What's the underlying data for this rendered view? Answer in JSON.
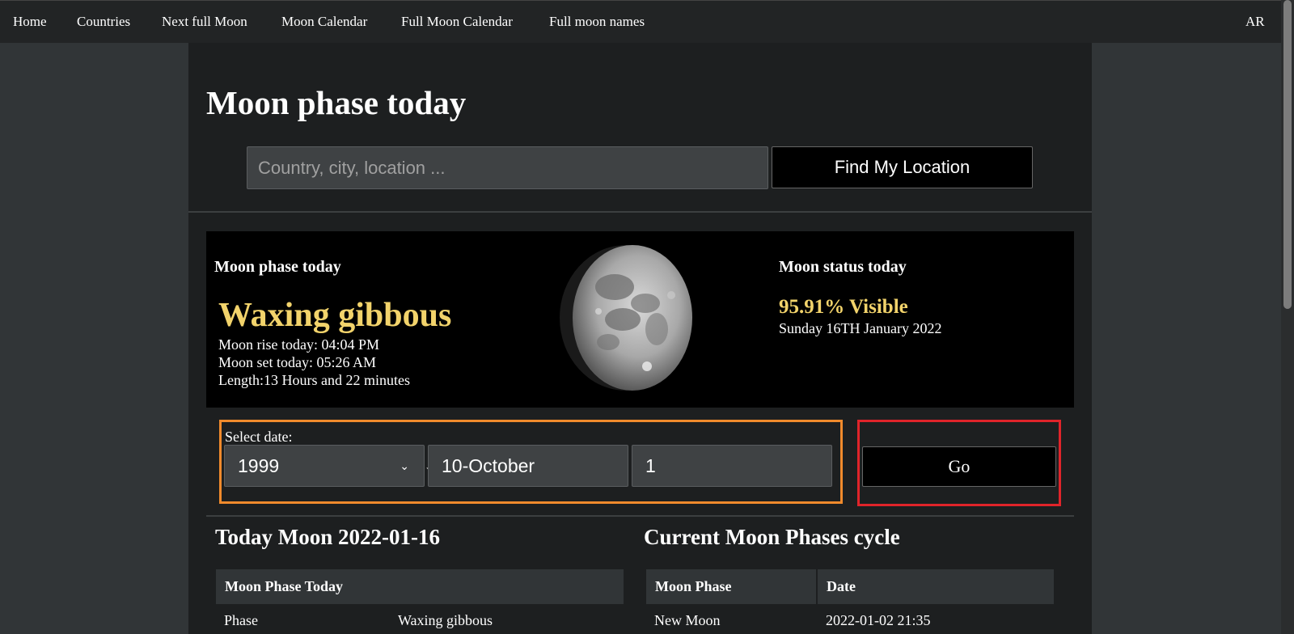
{
  "nav": {
    "items": [
      "Home",
      "Countries",
      "Next full Moon",
      "Moon Calendar",
      "Full Moon Calendar",
      "Full moon names"
    ],
    "lang": "AR"
  },
  "page": {
    "title": "Moon phase today",
    "search_placeholder": "Country, city, location ...",
    "locate_button": "Find My Location"
  },
  "hero": {
    "left_label": "Moon phase today",
    "phase_name": "Waxing gibbous",
    "moon_rise": "Moon rise today: 04:04 PM",
    "moon_set": "Moon set today: 05:26 AM",
    "length": "Length:13 Hours and 22 minutes",
    "right_label": "Moon status today",
    "visible": "95.91% Visible",
    "date_full": "Sunday 16TH January 2022",
    "illumination_percent": 95.91
  },
  "date_select": {
    "label": "Select date:",
    "year": "1999",
    "month": "10-October",
    "day": "1",
    "go_label": "Go"
  },
  "today_section": {
    "title": "Today Moon 2022-01-16",
    "table_header": "Moon Phase Today",
    "rows": [
      {
        "key": "Phase",
        "value": "Waxing gibbous"
      }
    ]
  },
  "cycle_section": {
    "title": "Current Moon Phases cycle",
    "headers": [
      "Moon Phase",
      "Date"
    ],
    "rows": [
      {
        "phase": "New Moon",
        "date": "2022-01-02 21:35"
      }
    ]
  },
  "colors": {
    "accent_yellow": "#f2d36b",
    "highlight_orange": "#f08a2c",
    "highlight_red": "#e0242a",
    "page_bg": "#313537",
    "panel_bg": "#1d1f20"
  }
}
